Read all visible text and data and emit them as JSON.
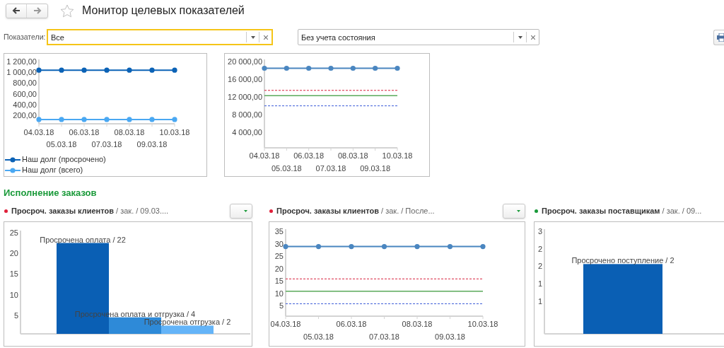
{
  "header": {
    "title": "Монитор целевых показателей",
    "favorite": false
  },
  "filters": {
    "label": "Показатели:",
    "fields": [
      {
        "value": "Все",
        "focused": true
      },
      {
        "value": "Без учета состояния",
        "focused": false
      }
    ]
  },
  "charts": [
    {
      "chart_data": {
        "type": "line",
        "categories": [
          "04.03.18",
          "05.03.18",
          "06.03.18",
          "07.03.18",
          "08.03.18",
          "09.03.18",
          "10.03.18"
        ],
        "ylim": [
          0,
          1200
        ],
        "yticks": [
          {
            "value": 200,
            "label": "200,00"
          },
          {
            "value": 400,
            "label": "400,00"
          },
          {
            "value": 600,
            "label": "600,00"
          },
          {
            "value": 800,
            "label": "800,00"
          },
          {
            "value": 1000,
            "label": "1 000,00"
          },
          {
            "value": 1200,
            "label": "1 200,00"
          }
        ],
        "legend": "bottom",
        "series": [
          {
            "name": "Наш долг (просрочено)",
            "color": "#0b62b6",
            "marker": "circle",
            "values": [
              1000,
              1000,
              1000,
              1000,
              1000,
              1000,
              1000
            ]
          },
          {
            "name": "Наш долг (всего)",
            "color": "#4aa8f2",
            "marker": "circle",
            "values": [
              80,
              80,
              80,
              80,
              80,
              80,
              80
            ]
          }
        ]
      }
    },
    {
      "chart_data": {
        "type": "line",
        "categories": [
          "04.03.18",
          "05.03.18",
          "06.03.18",
          "07.03.18",
          "08.03.18",
          "09.03.18",
          "10.03.18"
        ],
        "ylim": [
          0,
          20000
        ],
        "yticks": [
          {
            "value": 4000,
            "label": "4 000,00"
          },
          {
            "value": 8000,
            "label": "8 000,00"
          },
          {
            "value": 12000,
            "label": "12 000,00"
          },
          {
            "value": 16000,
            "label": "16 000,00"
          },
          {
            "value": 20000,
            "label": "20 000,00"
          }
        ],
        "series": [
          {
            "color": "#4a86c0",
            "marker": "circle",
            "values": [
              18000,
              18000,
              18000,
              18000,
              18000,
              18000,
              18000
            ]
          },
          {
            "color": "#d8203c",
            "line_style": "dashed",
            "values": [
              13000,
              13000,
              13000,
              13000,
              13000,
              13000,
              13000
            ]
          },
          {
            "color": "#5aaa5a",
            "values": [
              11800,
              11800,
              11800,
              11800,
              11800,
              11800,
              11800
            ]
          },
          {
            "color": "#3a5ad8",
            "line_style": "dashed",
            "values": [
              9500,
              9500,
              9500,
              9500,
              9500,
              9500,
              9500
            ]
          }
        ]
      }
    }
  ],
  "section": {
    "title": "Исполнение заказов",
    "panels": [
      {
        "title": "**Просроч. заказы клиентов** / зак. / 09.03....",
        "color": "#e0203a",
        "has_menu": true,
        "chart_data": {
          "type": "bar",
          "ylim": [
            0,
            25
          ],
          "yticks": [
            5,
            10,
            15,
            20,
            25
          ],
          "series": [
            {
              "colors": [
                "#0a5fb4",
                "#2e8ad8",
                "#64b4f8"
              ],
              "values": [
                22,
                4,
                2
              ]
            }
          ],
          "value_labels": [
            "Просрочена оплата / 22",
            "Просрочена оплата и отгрузка / 4",
            "Просрочена отгрузка / 2"
          ]
        }
      },
      {
        "title": "**Просроч. заказы клиентов** / зак. / После...",
        "color": "#e0203a",
        "has_menu": true,
        "chart_data": {
          "type": "line",
          "categories": [
            "04.03.18",
            "05.03.18",
            "06.03.18",
            "07.03.18",
            "08.03.18",
            "09.03.18",
            "10.03.18"
          ],
          "ylim": [
            0,
            35
          ],
          "yticks": [
            5,
            10,
            15,
            20,
            25,
            30,
            35
          ],
          "series": [
            {
              "color": "#4a86c0",
              "marker": "circle",
              "values": [
                28,
                28,
                28,
                28,
                28,
                28,
                28
              ]
            },
            {
              "color": "#d8203c",
              "line_style": "dashed",
              "values": [
                15,
                15,
                15,
                15,
                15,
                15,
                15
              ]
            },
            {
              "color": "#5aaa5a",
              "values": [
                10,
                10,
                10,
                10,
                10,
                10,
                10
              ]
            },
            {
              "color": "#3a5ad8",
              "line_style": "dashed",
              "values": [
                5,
                5,
                5,
                5,
                5,
                5,
                5
              ]
            }
          ]
        }
      },
      {
        "title": "**Просроч. заказы поставщикам** / зак. / 09...",
        "color": "#1a9a3a",
        "has_menu": false,
        "chart_data": {
          "type": "bar",
          "ylim": [
            0,
            3
          ],
          "yticks": [
            {
              "value": 1,
              "label": "1"
            },
            {
              "value": 1.5,
              "label": "1"
            },
            {
              "value": 2,
              "label": "2"
            },
            {
              "value": 2.5,
              "label": "2"
            },
            {
              "value": 3,
              "label": "3"
            }
          ],
          "series": [
            {
              "colors": [
                "#0a5fb4"
              ],
              "values": [
                2
              ]
            }
          ],
          "value_labels": [
            "Просрочено поступление / 2"
          ]
        }
      }
    ]
  }
}
